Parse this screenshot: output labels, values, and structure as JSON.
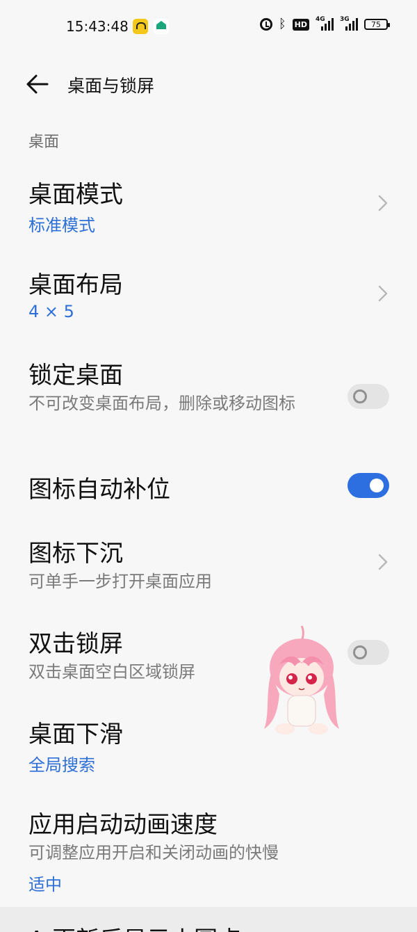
{
  "status_bar": {
    "time": "15:43:48",
    "hd_label": "HD",
    "signal1": "4G",
    "signal2": "3G",
    "battery": "75"
  },
  "header": {
    "title": "桌面与锁屏"
  },
  "section": {
    "label": "桌面"
  },
  "settings": {
    "desktop_mode": {
      "title": "桌面模式",
      "value": "标准模式"
    },
    "desktop_layout": {
      "title": "桌面布局",
      "value": "4 × 5"
    },
    "lock_desktop": {
      "title": "锁定桌面",
      "subtitle": "不可改变桌面布局，删除或移动图标",
      "enabled": false
    },
    "auto_fill": {
      "title": "图标自动补位",
      "enabled": true
    },
    "icon_sink": {
      "title": "图标下沉",
      "subtitle": "可单手一步打开桌面应用"
    },
    "double_tap_lock": {
      "title": "双击锁屏",
      "subtitle": "双击桌面空白区域锁屏",
      "enabled": false
    },
    "swipe_down": {
      "title": "桌面下滑",
      "value": "全局搜索"
    },
    "anim_speed": {
      "title": "应用启动动画速度",
      "subtitle": "可调整应用开启和关闭动画的快慢",
      "value": "适中"
    },
    "next_item": {
      "title": "A 更新后显示小圆点"
    }
  },
  "colors": {
    "accent": "#2d6fd6",
    "toggle_on": "#2d6fe0",
    "background": "#f7f7f7"
  }
}
